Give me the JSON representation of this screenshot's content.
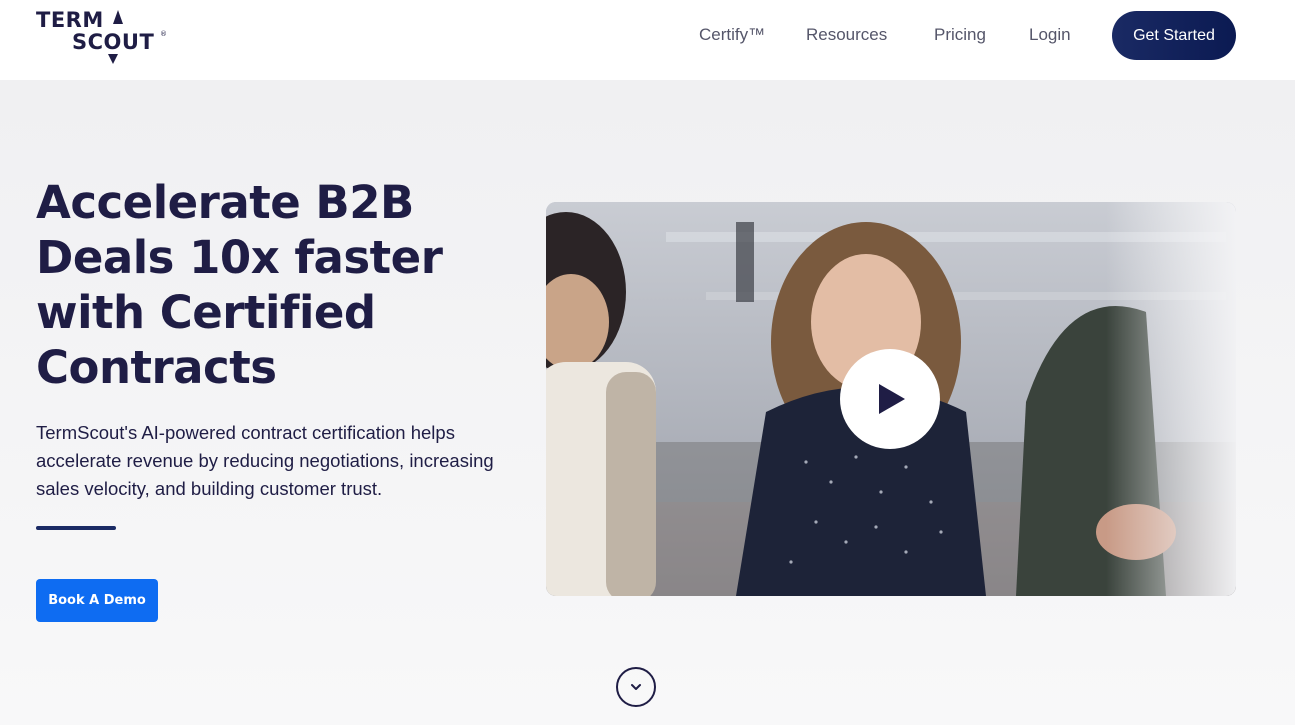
{
  "brand": {
    "line1": "TERM",
    "line2": "SCOUT",
    "reg": "®"
  },
  "nav": {
    "items": [
      {
        "label": "Certify™"
      },
      {
        "label": "Resources"
      },
      {
        "label": "Pricing"
      },
      {
        "label": "Login"
      }
    ],
    "cta_label": "Get Started"
  },
  "hero": {
    "headline": "Accelerate B2B Deals 10x faster with Certified Contracts",
    "subtext": "TermScout's AI-powered contract certification helps accelerate revenue by reducing negotiations, increasing sales velocity, and building customer trust.",
    "demo_button": "Book A Demo"
  },
  "video": {
    "play_icon": "play-icon"
  },
  "scroll": {
    "icon": "chevron-down-icon"
  },
  "colors": {
    "navy": "#1f1d45",
    "cta_dark": "#0b1a52",
    "primary_blue": "#0e6cf2",
    "nav_text": "#55566a",
    "background": "#f6f6f7"
  }
}
